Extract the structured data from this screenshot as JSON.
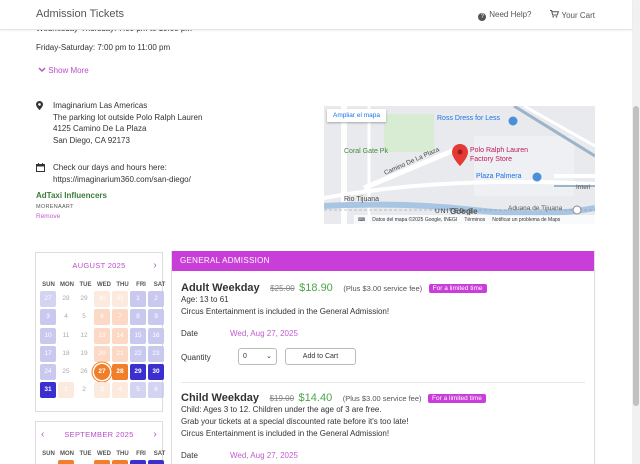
{
  "header": {
    "title": "Admission Tickets",
    "help_label": "Need Help?",
    "cart_label": "Your Cart",
    "help_icon": "question-circle-icon",
    "cart_icon": "cart-icon"
  },
  "hours": {
    "weekday": "Wednesday-Thursday: 7:00 pm to 10:00 pm",
    "weekend": "Friday-Saturday: 7:00 pm to 11:00 pm",
    "show_more": "Show More"
  },
  "venue": {
    "name": "Imaginarium Las Americas",
    "line2": "The parking lot outside Polo Ralph Lauren",
    "street": "4125 Camino De La Plaza",
    "city": "San Diego, CA 92173",
    "check_label": "Check our days and hours here:",
    "check_url": "https://imaginarium360.com/san-diego/"
  },
  "influencer": {
    "name": "AdTaxi Influencers",
    "code": "MORENAART",
    "remove": "Remove"
  },
  "map": {
    "enlarge": "Ampliar el mapa",
    "place_name": "Polo Ralph Lauren Factory Store",
    "labels": {
      "ross": "Ross Dress for Less",
      "coral": "Coral Gate Pk",
      "camino": "Camino De La Plaza",
      "palmera": "Plaza Palmera",
      "rio": "Rio Tijuana",
      "us": "UNITED S",
      "aduana": "Aduana de Tijuana",
      "inter": "Interi"
    },
    "google": "Google",
    "footer_data": "Datos del mapa ©2025 Google, INEGI",
    "footer_terms": "Términos",
    "footer_report": "Notificar un problema de Maps"
  },
  "calendar_aug": {
    "month": "AUGUST 2025",
    "dow": [
      "SUN",
      "MON",
      "TUE",
      "WED",
      "THU",
      "FRI",
      "SAT"
    ],
    "days": [
      {
        "n": "27",
        "s": "avail-out"
      },
      {
        "n": "28",
        "s": "past"
      },
      {
        "n": "29",
        "s": "past"
      },
      {
        "n": "30",
        "s": "peach-out"
      },
      {
        "n": "31",
        "s": "peach-out"
      },
      {
        "n": "1",
        "s": "avail"
      },
      {
        "n": "2",
        "s": "avail"
      },
      {
        "n": "3",
        "s": "avail"
      },
      {
        "n": "4",
        "s": "past"
      },
      {
        "n": "5",
        "s": "past"
      },
      {
        "n": "6",
        "s": "peach"
      },
      {
        "n": "7",
        "s": "peach"
      },
      {
        "n": "8",
        "s": "avail"
      },
      {
        "n": "9",
        "s": "avail"
      },
      {
        "n": "10",
        "s": "avail"
      },
      {
        "n": "11",
        "s": "past"
      },
      {
        "n": "12",
        "s": "past"
      },
      {
        "n": "13",
        "s": "peach"
      },
      {
        "n": "14",
        "s": "peach"
      },
      {
        "n": "15",
        "s": "avail"
      },
      {
        "n": "16",
        "s": "avail"
      },
      {
        "n": "17",
        "s": "avail"
      },
      {
        "n": "18",
        "s": "past"
      },
      {
        "n": "19",
        "s": "past"
      },
      {
        "n": "20",
        "s": "peach"
      },
      {
        "n": "21",
        "s": "peach"
      },
      {
        "n": "22",
        "s": "avail"
      },
      {
        "n": "23",
        "s": "avail"
      },
      {
        "n": "24",
        "s": "avail"
      },
      {
        "n": "25",
        "s": "past"
      },
      {
        "n": "26",
        "s": "past"
      },
      {
        "n": "27",
        "s": "sel"
      },
      {
        "n": "28",
        "s": "orange"
      },
      {
        "n": "29",
        "s": "dark"
      },
      {
        "n": "30",
        "s": "dark"
      },
      {
        "n": "31",
        "s": "dark"
      },
      {
        "n": "1",
        "s": "peach-out"
      },
      {
        "n": "2",
        "s": "past"
      },
      {
        "n": "3",
        "s": "peach-out"
      },
      {
        "n": "4",
        "s": "peach-out"
      },
      {
        "n": "5",
        "s": "avail-out"
      },
      {
        "n": "6",
        "s": "avail-out"
      }
    ]
  },
  "calendar_sep": {
    "month": "SEPTEMBER 2025",
    "dow": [
      "SUN",
      "MON",
      "TUE",
      "WED",
      "THU",
      "FRI",
      "SAT"
    ],
    "days": []
  },
  "tickets": {
    "section_title": "GENERAL ADMISSION",
    "items": [
      {
        "name": "Adult Weekday",
        "old_price": "$25.00",
        "new_price": "$18.90",
        "fee": "(Plus $3.00 service fee)",
        "badge": "For a limited time",
        "desc": [
          "Age: 13 to 61",
          "Circus Entertainment is included in the General Admission!"
        ],
        "date_label": "Date",
        "date_value": "Wed, Aug 27, 2025",
        "qty_label": "Quantity",
        "qty_value": "0",
        "add_label": "Add to Cart"
      },
      {
        "name": "Child Weekday",
        "old_price": "$19.00",
        "new_price": "$14.40",
        "fee": "(Plus $3.00 service fee)",
        "badge": "For a limited time",
        "desc": [
          "Child: Ages 3 to 12. Children under the age of 3 are free.",
          "Grab your tickets at a special discounted rate before it's too late!",
          "Circus Entertainment is included in the General Admission!"
        ],
        "date_label": "Date",
        "date_value": "Wed, Aug 27, 2025"
      }
    ]
  }
}
